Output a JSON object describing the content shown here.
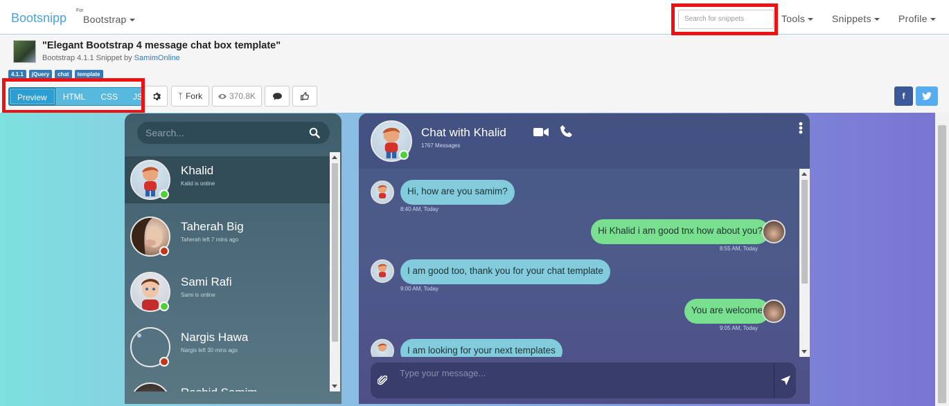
{
  "navbar": {
    "brand": "Bootsnipp",
    "for_label": "For",
    "framework_menu": "Bootstrap",
    "search_placeholder": "Search for snippets",
    "menu": [
      "Tools",
      "Snippets",
      "Profile"
    ]
  },
  "snippet": {
    "title": "\"Elegant Bootstrap 4 message chat box template\"",
    "subtitle_prefix": "Bootstrap 4.1.1 Snippet by ",
    "author": "SamimOnline",
    "tags": [
      "4.1.1",
      "jQuery",
      "chat",
      "template"
    ]
  },
  "toolbar": {
    "tabs": [
      "Preview",
      "HTML",
      "CSS",
      "JS"
    ],
    "active_tab": "Preview",
    "fork_label": "Fork",
    "views": "370.8K",
    "social": {
      "facebook": "f",
      "twitter_color": "#55acee",
      "facebook_color": "#3b5998"
    }
  },
  "contacts": {
    "search_placeholder": "Search...",
    "items": [
      {
        "name": "Khalid",
        "status": "Kalid is online",
        "online": true
      },
      {
        "name": "Taherah Big",
        "status": "Taherah left 7 mins ago",
        "online": false
      },
      {
        "name": "Sami Rafi",
        "status": "Sami is online",
        "online": true
      },
      {
        "name": "Nargis Hawa",
        "status": "Nargis left 30 mins ago",
        "online": false
      },
      {
        "name": "Rashid Samim",
        "status": "",
        "online": false
      }
    ]
  },
  "chat": {
    "title": "Chat with Khalid",
    "message_count": "1767 Messages",
    "messages": [
      {
        "side": "in",
        "text": "Hi, how are you samim?",
        "time": "8:40 AM, Today"
      },
      {
        "side": "out",
        "text": "Hi Khalid i am good tnx how about you?",
        "time": "8:55 AM, Today"
      },
      {
        "side": "in",
        "text": "I am good too, thank you for your chat template",
        "time": "9:00 AM, Today"
      },
      {
        "side": "out",
        "text": "You are welcome",
        "time": "9:05 AM, Today"
      },
      {
        "side": "in",
        "text": "I am looking for your next templates",
        "time": ""
      }
    ],
    "composer_placeholder": "Type your message..."
  },
  "colors": {
    "online": "#4cd137",
    "offline": "#c23616",
    "incoming_bubble": "#82ccdd",
    "outgoing_bubble": "#78e08f",
    "highlight": "#ee1111"
  }
}
